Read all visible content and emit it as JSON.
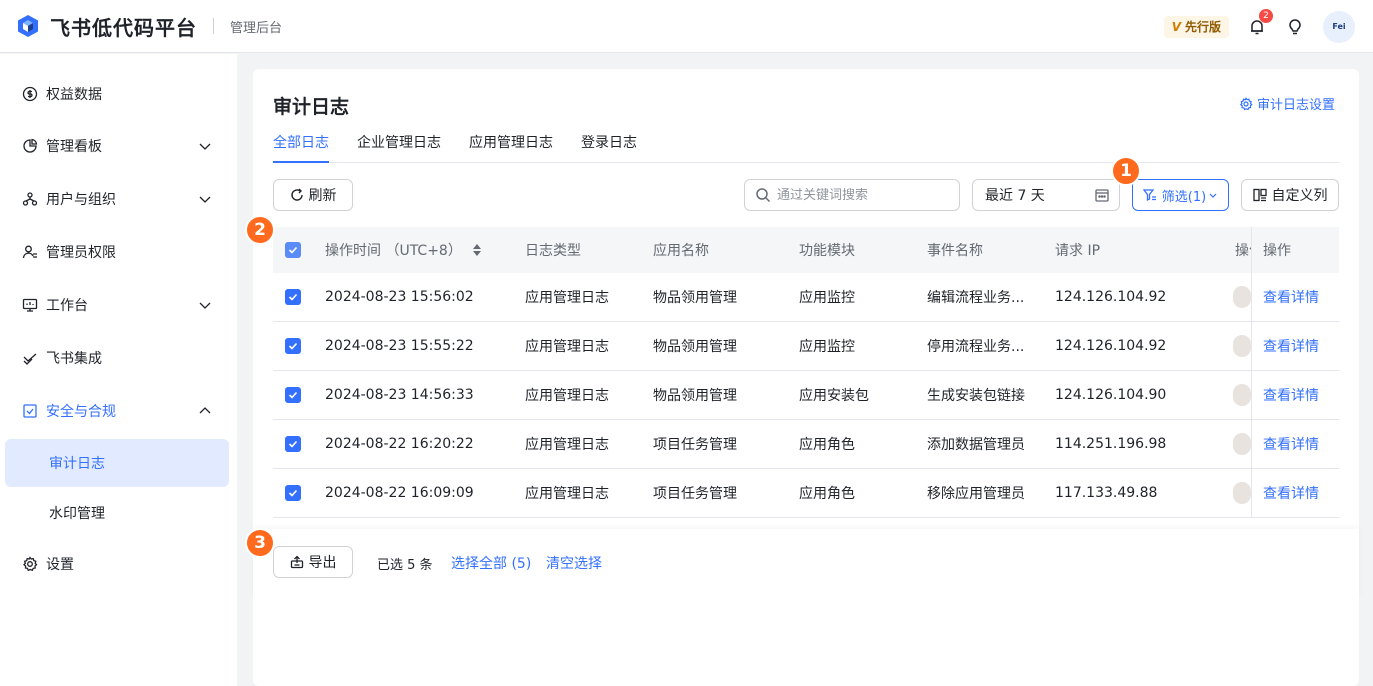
{
  "header": {
    "app_title": "飞书低代码平台",
    "sub_title": "管理后台",
    "version_badge": "先行版",
    "version_letter": "V",
    "notification_count": "2",
    "avatar_text": "Fei"
  },
  "sidebar": {
    "items": [
      {
        "label": "权益数据",
        "icon": "dollar-circle-icon"
      },
      {
        "label": "管理看板",
        "icon": "pie-chart-icon"
      },
      {
        "label": "用户与组织",
        "icon": "org-icon"
      },
      {
        "label": "管理员权限",
        "icon": "admin-icon"
      },
      {
        "label": "工作台",
        "icon": "monitor-icon"
      },
      {
        "label": "飞书集成",
        "icon": "integration-icon"
      },
      {
        "label": "安全与合规",
        "icon": "shield-icon"
      },
      {
        "label": "设置",
        "icon": "gear-icon"
      }
    ],
    "sub_items": [
      {
        "label": "审计日志"
      },
      {
        "label": "水印管理"
      }
    ]
  },
  "page": {
    "title": "审计日志",
    "settings_link": "审计日志设置",
    "tabs": [
      "全部日志",
      "企业管理日志",
      "应用管理日志",
      "登录日志"
    ]
  },
  "toolbar": {
    "refresh_label": "刷新",
    "search_placeholder": "通过关键词搜索",
    "date_range": "最近 7 天",
    "filter_label": "筛选(1)",
    "custom_columns_label": "自定义列"
  },
  "table": {
    "headers": {
      "time": "操作时间 （UTC+8）",
      "log_type": "日志类型",
      "app_name": "应用名称",
      "module": "功能模块",
      "event": "事件名称",
      "ip": "请求 IP",
      "operator": "操作",
      "actions": "操作"
    },
    "rows": [
      {
        "time": "2024-08-23 15:56:02",
        "log_type": "应用管理日志",
        "app_name": "物品领用管理",
        "module": "应用监控",
        "event": "编辑流程业务...",
        "ip": "124.126.104.92",
        "action": "查看详情"
      },
      {
        "time": "2024-08-23 15:55:22",
        "log_type": "应用管理日志",
        "app_name": "物品领用管理",
        "module": "应用监控",
        "event": "停用流程业务...",
        "ip": "124.126.104.92",
        "action": "查看详情"
      },
      {
        "time": "2024-08-23 14:56:33",
        "log_type": "应用管理日志",
        "app_name": "物品领用管理",
        "module": "应用安装包",
        "event": "生成安装包链接",
        "ip": "124.126.104.90",
        "action": "查看详情"
      },
      {
        "time": "2024-08-22 16:20:22",
        "log_type": "应用管理日志",
        "app_name": "项目任务管理",
        "module": "应用角色",
        "event": "添加数据管理员",
        "ip": "114.251.196.98",
        "action": "查看详情"
      },
      {
        "time": "2024-08-22 16:09:09",
        "log_type": "应用管理日志",
        "app_name": "项目任务管理",
        "module": "应用角色",
        "event": "移除应用管理员",
        "ip": "117.133.49.88",
        "action": "查看详情"
      }
    ]
  },
  "footer": {
    "export_label": "导出",
    "selected_count": "已选 5 条",
    "select_all": "选择全部 (5)",
    "clear_selection": "清空选择"
  },
  "markers": [
    "1",
    "2",
    "3"
  ],
  "colors": {
    "accent": "#3370ff",
    "marker": "#ff6a1f"
  }
}
